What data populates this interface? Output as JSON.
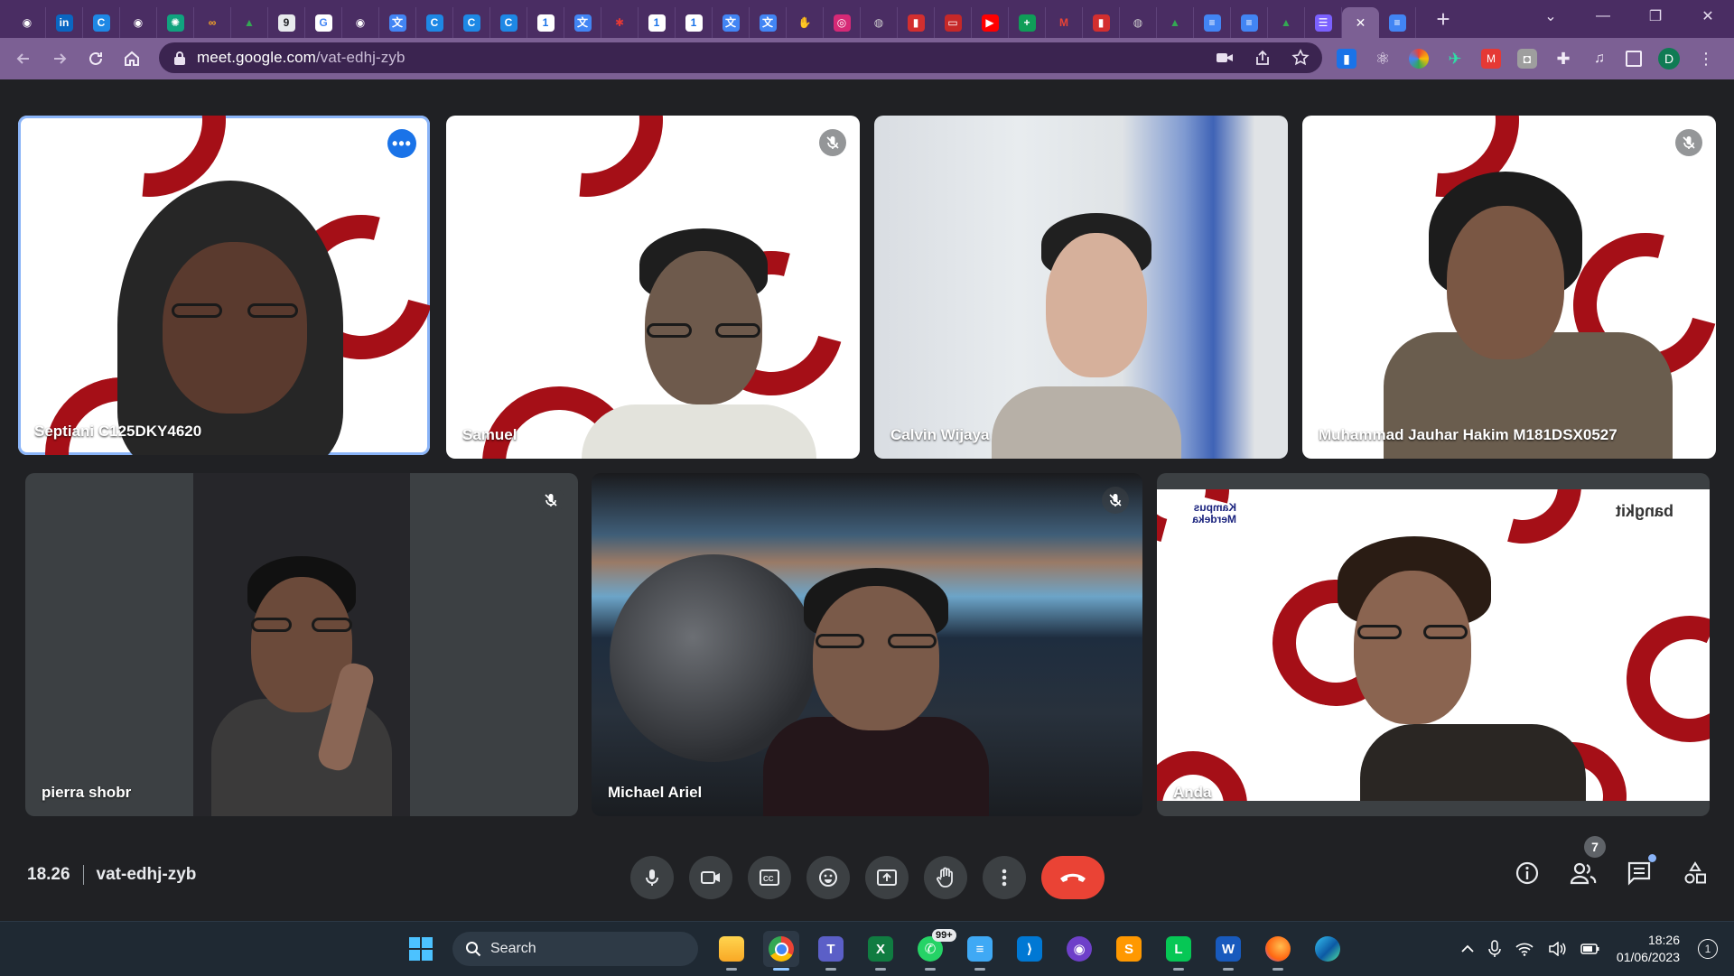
{
  "browser": {
    "tab_favicons": [
      {
        "icon": "github-icon",
        "glyph": "◉",
        "color": "#ffffff",
        "bg": "transparent"
      },
      {
        "icon": "linkedin-icon",
        "glyph": "in",
        "color": "#ffffff",
        "bg": "#0a66c2"
      },
      {
        "icon": "c-app-icon",
        "glyph": "C",
        "color": "#ffffff",
        "bg": "#1e88e5"
      },
      {
        "icon": "github-icon",
        "glyph": "◉",
        "color": "#ffffff",
        "bg": "transparent"
      },
      {
        "icon": "chatgpt-icon",
        "glyph": "✺",
        "color": "#ffffff",
        "bg": "#10a37f"
      },
      {
        "icon": "infinity-icon",
        "glyph": "∞",
        "color": "#f9a825",
        "bg": "transparent"
      },
      {
        "icon": "google-drive-icon",
        "glyph": "▲",
        "color": "#34a853",
        "bg": "transparent"
      },
      {
        "icon": "g-app-icon",
        "glyph": "9",
        "color": "#202124",
        "bg": "#e8eaed"
      },
      {
        "icon": "google-icon",
        "glyph": "G",
        "color": "#4285f4",
        "bg": "#ffffff"
      },
      {
        "icon": "github-icon",
        "glyph": "◉",
        "color": "#ffffff",
        "bg": "transparent"
      },
      {
        "icon": "google-translate-icon",
        "glyph": "文",
        "color": "#ffffff",
        "bg": "#4285f4"
      },
      {
        "icon": "c-app-icon",
        "glyph": "C",
        "color": "#ffffff",
        "bg": "#1e88e5"
      },
      {
        "icon": "c-app-icon",
        "glyph": "C",
        "color": "#ffffff",
        "bg": "#1e88e5"
      },
      {
        "icon": "c-app-icon",
        "glyph": "C",
        "color": "#ffffff",
        "bg": "#1e88e5"
      },
      {
        "icon": "google-calendar-icon",
        "glyph": "1",
        "color": "#1a73e8",
        "bg": "#ffffff"
      },
      {
        "icon": "google-translate-icon",
        "glyph": "文",
        "color": "#ffffff",
        "bg": "#4285f4"
      },
      {
        "icon": "bangkit-icon",
        "glyph": "✱",
        "color": "#e53935",
        "bg": "transparent"
      },
      {
        "icon": "google-calendar-icon",
        "glyph": "1",
        "color": "#1a73e8",
        "bg": "#ffffff"
      },
      {
        "icon": "google-calendar-icon",
        "glyph": "1",
        "color": "#1a73e8",
        "bg": "#ffffff"
      },
      {
        "icon": "google-translate-icon",
        "glyph": "文",
        "color": "#ffffff",
        "bg": "#4285f4"
      },
      {
        "icon": "google-translate-icon",
        "glyph": "文",
        "color": "#ffffff",
        "bg": "#4285f4"
      },
      {
        "icon": "hand-icon",
        "glyph": "✋",
        "color": "#fbc02d",
        "bg": "transparent"
      },
      {
        "icon": "instagram-icon",
        "glyph": "◎",
        "color": "#ffffff",
        "bg": "#d62976"
      },
      {
        "icon": "globe-icon",
        "glyph": "◍",
        "color": "#cfcfcf",
        "bg": "transparent"
      },
      {
        "icon": "docs-red-icon",
        "glyph": "▮",
        "color": "#ffffff",
        "bg": "#d32f2f"
      },
      {
        "icon": "news-icon",
        "glyph": "▭",
        "color": "#ffffff",
        "bg": "#c62828"
      },
      {
        "icon": "youtube-icon",
        "glyph": "▶",
        "color": "#ffffff",
        "bg": "#ff0000"
      },
      {
        "icon": "sheets-plus-icon",
        "glyph": "+",
        "color": "#ffffff",
        "bg": "#0f9d58"
      },
      {
        "icon": "gmail-icon",
        "glyph": "M",
        "color": "#ea4335",
        "bg": "transparent"
      },
      {
        "icon": "docs-red-icon",
        "glyph": "▮",
        "color": "#ffffff",
        "bg": "#d32f2f"
      },
      {
        "icon": "globe-icon",
        "glyph": "◍",
        "color": "#cfcfcf",
        "bg": "transparent"
      },
      {
        "icon": "google-drive-icon",
        "glyph": "▲",
        "color": "#34a853",
        "bg": "transparent"
      },
      {
        "icon": "google-docs-icon",
        "glyph": "≡",
        "color": "#ffffff",
        "bg": "#4285f4"
      },
      {
        "icon": "google-docs-icon",
        "glyph": "≡",
        "color": "#ffffff",
        "bg": "#4285f4"
      },
      {
        "icon": "google-drive-icon",
        "glyph": "▲",
        "color": "#34a853",
        "bg": "transparent"
      },
      {
        "icon": "tasks-icon",
        "glyph": "☰",
        "color": "#ffffff",
        "bg": "#7b61ff"
      }
    ],
    "active_tab_close": "✕",
    "after_active_favicon": {
      "icon": "google-docs-icon",
      "glyph": "≡",
      "color": "#ffffff",
      "bg": "#4285f4"
    },
    "new_tab": "+",
    "window_controls": [
      "⌄",
      "—",
      "❐",
      "✕"
    ],
    "url_host": "meet.google.com",
    "url_path": "/vat-edhj-zyb",
    "profile_initial": "D"
  },
  "meet": {
    "participants": [
      {
        "name": "Septiani C125DKY4620"
      },
      {
        "name": "Samuel"
      },
      {
        "name": "Calvin Wijaya"
      },
      {
        "name": "Muhammad Jauhar Hakim M181DSX0527"
      },
      {
        "name": "pierra shobr"
      },
      {
        "name": "Michael Ariel"
      },
      {
        "name": "Anda"
      }
    ],
    "more_options_glyph": "•••",
    "bg_logo_text": {
      "kampus": "Kampus Merdeka",
      "bangkit": "bangkit"
    },
    "time": "18.26",
    "meeting_code": "vat-edhj-zyb",
    "people_count": "7"
  },
  "taskbar": {
    "search_label": "Search",
    "whatsapp_badge": "99+",
    "time": "18:26",
    "date": "01/06/2023",
    "notification_count": "1"
  },
  "colors": {
    "tabstrip": "#4a2d63",
    "toolbar": "#7c6094",
    "meet_bg": "#202124",
    "hangup": "#ea4335",
    "accent_blue": "#8ab4f8",
    "brand_red": "#a50f17"
  }
}
